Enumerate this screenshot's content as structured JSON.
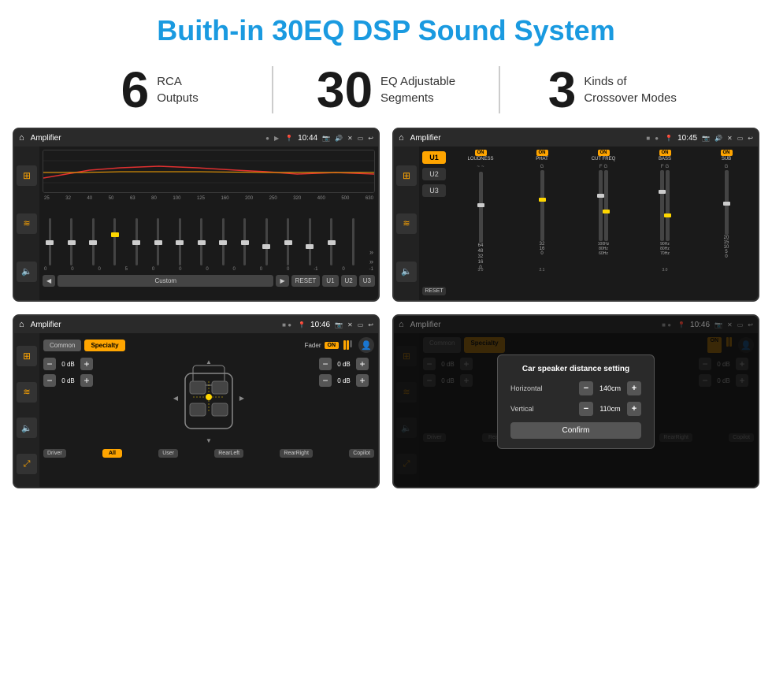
{
  "page": {
    "title": "Buith-in 30EQ DSP Sound System"
  },
  "stats": [
    {
      "number": "6",
      "label_line1": "RCA",
      "label_line2": "Outputs"
    },
    {
      "number": "30",
      "label_line1": "EQ Adjustable",
      "label_line2": "Segments"
    },
    {
      "number": "3",
      "label_line1": "Kinds of",
      "label_line2": "Crossover Modes"
    }
  ],
  "screen1": {
    "status_title": "Amplifier",
    "time": "10:44",
    "freq_labels": [
      "25",
      "32",
      "40",
      "50",
      "63",
      "80",
      "100",
      "125",
      "160",
      "200",
      "250",
      "320",
      "400",
      "500",
      "630"
    ],
    "val_labels": [
      "0",
      "0",
      "0",
      "5",
      "0",
      "0",
      "0",
      "0",
      "0",
      "0",
      "-1",
      "0",
      "-1"
    ],
    "bottom_buttons": [
      "◀",
      "Custom",
      "▶",
      "RESET",
      "U1",
      "U2",
      "U3"
    ]
  },
  "screen2": {
    "status_title": "Amplifier",
    "time": "10:45",
    "channels": [
      "LOUDNESS",
      "PHAT",
      "CUT FREQ",
      "BASS",
      "SUB"
    ],
    "u_buttons": [
      "U1",
      "U2",
      "U3"
    ],
    "reset_label": "RESET"
  },
  "screen3": {
    "status_title": "Amplifier",
    "time": "10:46",
    "tabs": [
      "Common",
      "Specialty"
    ],
    "fader_label": "Fader",
    "on_label": "ON",
    "db_values": [
      "0 dB",
      "0 dB",
      "0 dB",
      "0 dB"
    ],
    "bottom_labels": [
      "Driver",
      "All",
      "User",
      "RearLeft",
      "RearRight",
      "Copilot"
    ]
  },
  "screen4": {
    "status_title": "Amplifier",
    "time": "10:46",
    "tabs": [
      "Common",
      "Specialty"
    ],
    "dialog": {
      "title": "Car speaker distance setting",
      "horizontal_label": "Horizontal",
      "horizontal_value": "140cm",
      "vertical_label": "Vertical",
      "vertical_value": "110cm",
      "confirm_label": "Confirm"
    },
    "bottom_labels": [
      "Driver",
      "RearLeft",
      "User",
      "RearRight",
      "Copilot"
    ]
  }
}
